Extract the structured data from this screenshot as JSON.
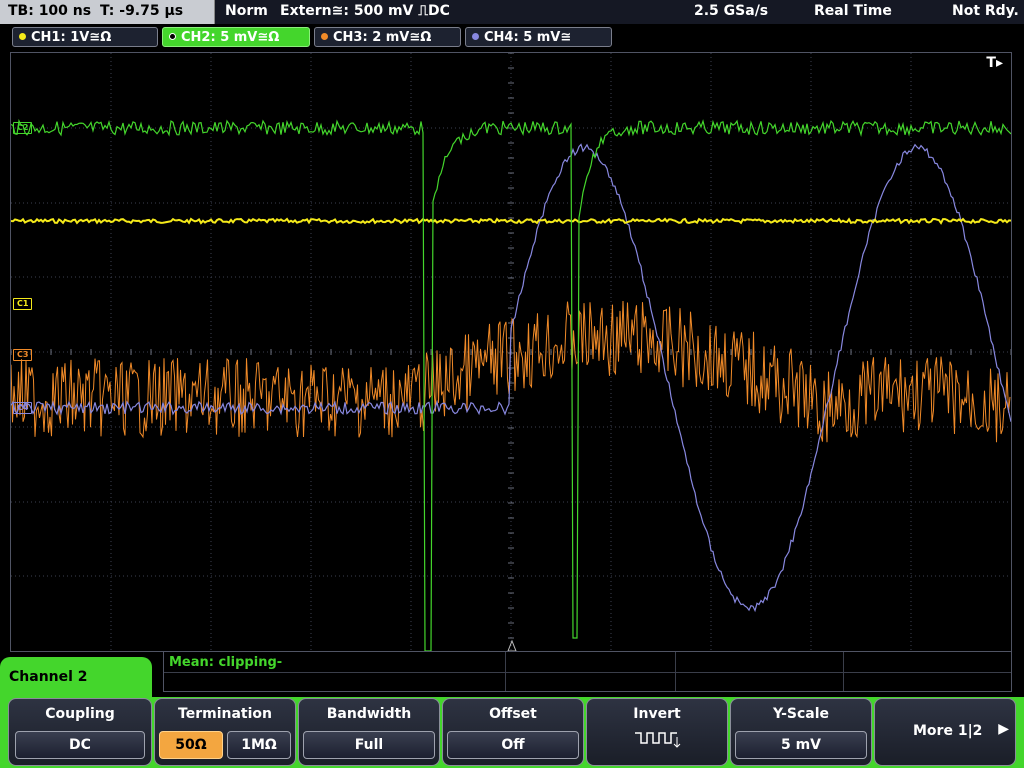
{
  "status": {
    "timebase": "TB: 100 ns",
    "trigger_time": "T: -9.75 µs",
    "mode": "Norm",
    "trigger": "Extern≅: 500 mV ⎍DC",
    "sample_rate": "2.5 GSa/s",
    "acq_mode": "Real Time",
    "state": "Not Rdy."
  },
  "channels": [
    {
      "label": "CH1: 1V≅Ω",
      "color": "#f5ea1a"
    },
    {
      "label": "CH2: 5 mV≅Ω",
      "color": "#44d62c"
    },
    {
      "label": "CH3: 2 mV≅Ω",
      "color": "#f08a28"
    },
    {
      "label": "CH4: 5 mV≅",
      "color": "#8888e0"
    }
  ],
  "screen": {
    "trigger_marker": "T▸",
    "markers": {
      "ch1": "C1",
      "ch2": "C2",
      "ch3": "C3",
      "ch4": "C4"
    }
  },
  "measurement": {
    "text": "Mean: clipping-"
  },
  "menu": {
    "title": "Channel 2",
    "coupling": {
      "title": "Coupling",
      "value": "DC"
    },
    "termination": {
      "title": "Termination",
      "option_a": "50Ω",
      "option_b": "1MΩ",
      "selected": "50Ω"
    },
    "bandwidth": {
      "title": "Bandwidth",
      "value": "Full"
    },
    "offset": {
      "title": "Offset",
      "value": "Off"
    },
    "invert": {
      "title": "Invert"
    },
    "yscale": {
      "title": "Y-Scale",
      "value": "5 mV"
    },
    "more": {
      "label": "More 1|2"
    }
  }
}
